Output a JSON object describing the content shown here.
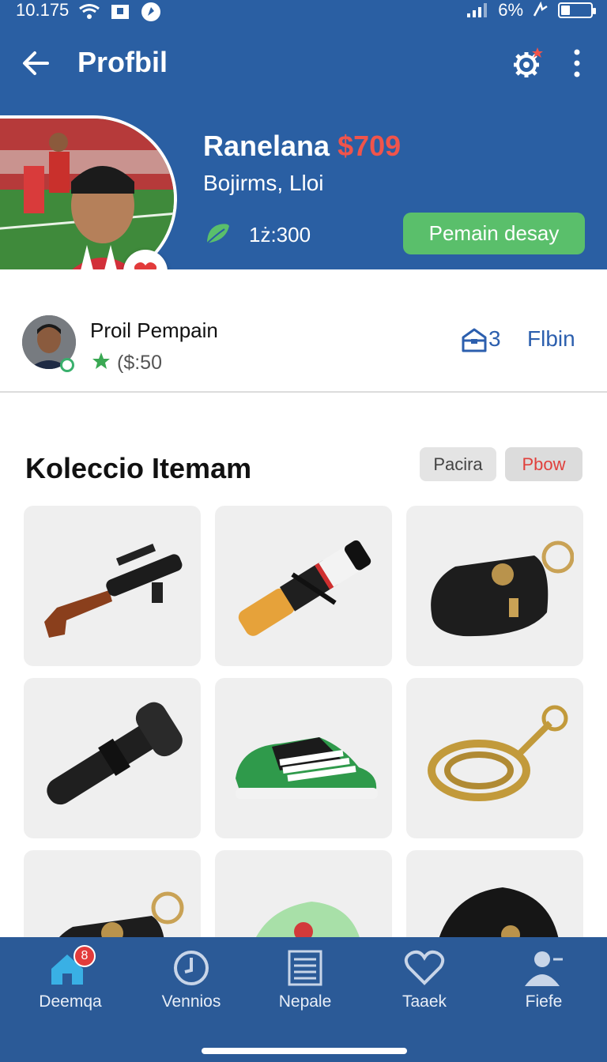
{
  "status_bar": {
    "time": "10.175",
    "battery_text": "6%",
    "battery_level": 0.3,
    "icons": [
      "wifi-icon",
      "sim-icon",
      "compass-icon",
      "signal-icon",
      "data-icon",
      "battery-icon"
    ]
  },
  "app_bar": {
    "title": "Profbil",
    "back_icon": "arrow-left-icon",
    "settings_icon": "gear-icon",
    "more_icon": "more-vertical-icon"
  },
  "profile": {
    "name": "Ranelana",
    "price": "$709",
    "subtitle": "Bojirms, Lloi",
    "points": "1ż:300",
    "cta_label": "Pemain desay",
    "colors": {
      "price": "#f0544b",
      "cta": "#5abf6b",
      "header": "#2a5fa3"
    }
  },
  "player": {
    "title": "Proil Pempain",
    "rating": "($:50",
    "inventory_count": "3",
    "follow_label": "Flbin"
  },
  "collection": {
    "title": "Koleccio Itemam",
    "chips": [
      "Pacira",
      "Pbow"
    ],
    "items": [
      {
        "name": "rifle"
      },
      {
        "name": "tube"
      },
      {
        "name": "pouch"
      },
      {
        "name": "handle"
      },
      {
        "name": "sneaker"
      },
      {
        "name": "chain"
      },
      {
        "name": "pouch"
      },
      {
        "name": "green-cap"
      },
      {
        "name": "black-cap"
      }
    ]
  },
  "nav": [
    {
      "label": "Deemqa",
      "icon": "home-icon",
      "badge": "8"
    },
    {
      "label": "Vennios",
      "icon": "clock-icon"
    },
    {
      "label": "Nepale",
      "icon": "list-icon"
    },
    {
      "label": "Taaek",
      "icon": "heart-icon"
    },
    {
      "label": "Fiefe",
      "icon": "user-icon"
    }
  ]
}
